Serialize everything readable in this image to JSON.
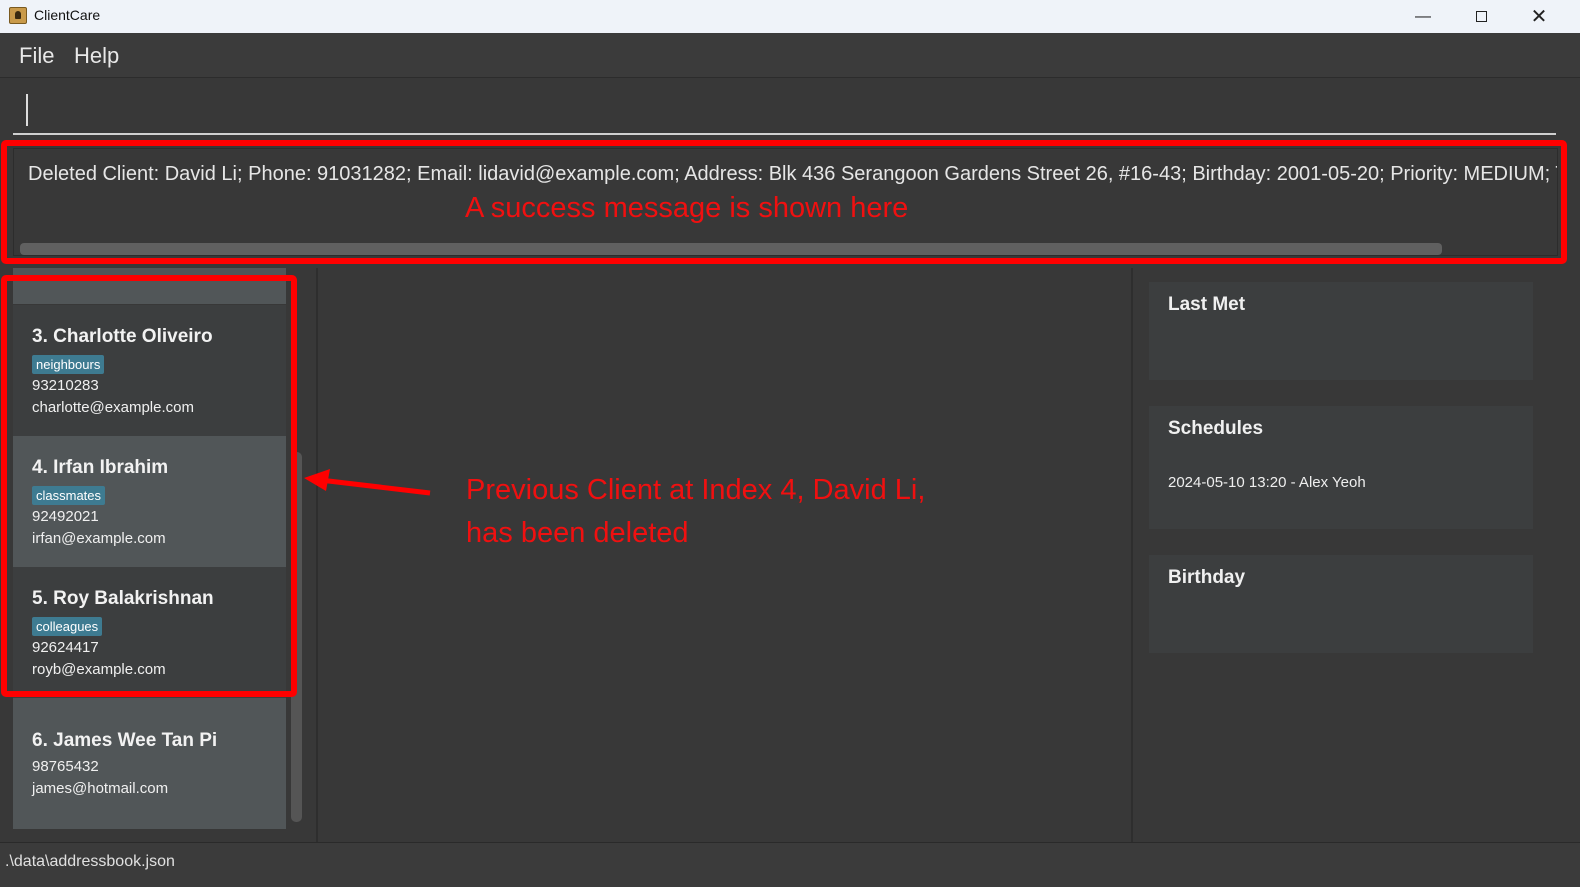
{
  "window": {
    "title": "ClientCare",
    "minimize_icon": "minimize-icon",
    "maximize_icon": "maximize-icon",
    "close_icon": "close-icon"
  },
  "menu": [
    "File",
    "Help"
  ],
  "command": {
    "value": ""
  },
  "result": {
    "message": "Deleted Client: David Li; Phone: 91031282; Email: lidavid@example.com; Address: Blk 436 Serangoon Gardens Street 26, #16-43; Birthday: 2001-05-20; Priority: MEDIUM; Ta"
  },
  "clients": [
    {
      "name": "3.  Charlotte Oliveiro",
      "tag": "neighbours",
      "phone": "93210283",
      "email": "charlotte@example.com"
    },
    {
      "name": "4.  Irfan Ibrahim",
      "tag": "classmates",
      "phone": "92492021",
      "email": "irfan@example.com"
    },
    {
      "name": "5.  Roy Balakrishnan",
      "tag": "colleagues",
      "phone": "92624417",
      "email": "royb@example.com"
    },
    {
      "name": "6.  James Wee Tan Pi",
      "phone": "98765432",
      "email": "james@hotmail.com"
    }
  ],
  "side": {
    "last_met": "Last Met",
    "schedules": "Schedules",
    "schedule_items": [
      "2024-05-10 13:20 - Alex Yeoh"
    ],
    "birthday": "Birthday"
  },
  "status": {
    "path": ".\\data\\addressbook.json"
  },
  "annotations": {
    "success_note": "A success message is shown here",
    "delete_note_1": "Previous Client at Index 4, David Li,",
    "delete_note_2": "has been deleted",
    "color": "#ff0000"
  }
}
